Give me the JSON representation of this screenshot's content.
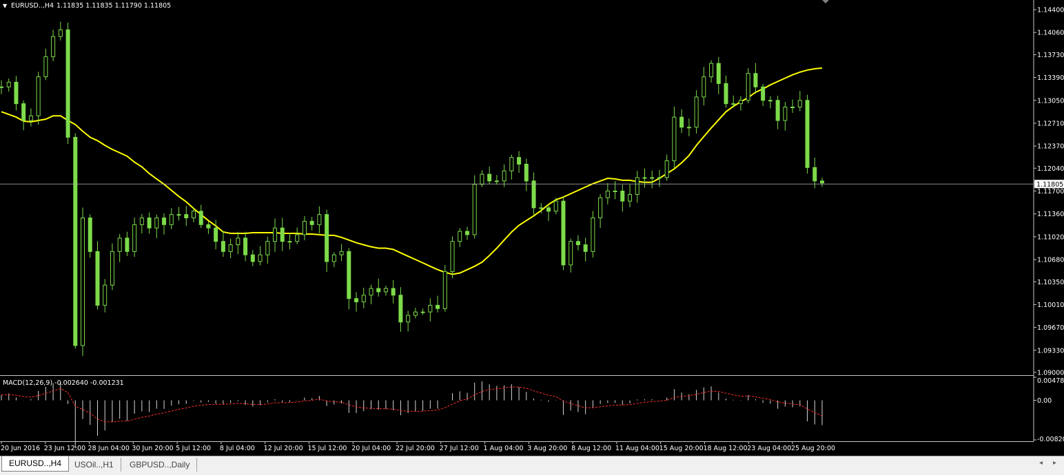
{
  "header": {
    "symbol_label": "EURUSD..,H4",
    "ohlc": "1.11835 1.11835 1.11790 1.11805"
  },
  "macd": {
    "label": "MACD(12,26,9) -0.002640 -0.001231",
    "ticks": [
      "0.004787",
      "0.00",
      "-0.008208"
    ]
  },
  "current_price_label": "1.11805",
  "tabs": [
    {
      "label": "EURUSD..,H4",
      "active": true
    },
    {
      "label": "USOil..,H1",
      "active": false
    },
    {
      "label": "GBPUSD..,Daily",
      "active": false
    }
  ],
  "colors": {
    "background": "#000000",
    "candle": "#7ddb4a",
    "moving_average": "#ffff00",
    "macd_histogram": "#d8d8d8",
    "macd_signal": "#ff3030",
    "axis_text": "#ffffff",
    "price_line": "#b8b8b8"
  },
  "chart_data": {
    "type": "line",
    "ylim": [
      1.09,
      1.144
    ],
    "yticks": [
      "1.14400",
      "1.14060",
      "1.13730",
      "1.13390",
      "1.13050",
      "1.12710",
      "1.12370",
      "1.12040",
      "1.11700",
      "1.11360",
      "1.11020",
      "1.10680",
      "1.10350",
      "1.10010",
      "1.09670",
      "1.09330",
      "1.09000"
    ],
    "xticks": [
      "20 Jun 2016",
      "23 Jun 12:00",
      "28 Jun 04:00",
      "30 Jun 20:00",
      "5 Jul 12:00",
      "8 Jul 04:00",
      "12 Jul 20:00",
      "15 Jul 12:00",
      "20 Jul 04:00",
      "22 Jul 20:00",
      "27 Jul 12:00",
      "1 Aug 04:00",
      "3 Aug 20:00",
      "8 Aug 12:00",
      "11 Aug 04:00",
      "15 Aug 20:00",
      "18 Aug 12:00",
      "23 Aug 04:00",
      "25 Aug 20:00"
    ],
    "current_price": 1.11805,
    "series": [
      {
        "values": [
          1.1325,
          1.1332,
          1.13,
          1.1275,
          1.1282,
          1.134,
          1.137,
          1.14,
          1.141,
          1.125,
          1.094,
          1.113,
          1.108,
          1.1,
          1.103,
          1.108,
          1.11,
          1.108,
          1.112,
          1.113,
          1.1115,
          1.113,
          1.112,
          1.1135,
          1.1135,
          1.113,
          1.114,
          1.112,
          1.1115,
          1.1095,
          1.108,
          1.109,
          1.11,
          1.1075,
          1.1065,
          1.1075,
          1.1095,
          1.1115,
          1.1095,
          1.1095,
          1.1105,
          1.1125,
          1.112,
          1.1135,
          1.1065,
          1.1075,
          1.108,
          1.101,
          1.1005,
          1.1015,
          1.1025,
          1.102,
          1.1025,
          1.1015,
          1.0975,
          1.0985,
          1.099,
          1.099,
          1.1,
          1.0995,
          1.105,
          1.1095,
          1.111,
          1.1105,
          1.118,
          1.1195,
          1.1185,
          1.1185,
          1.12,
          1.122,
          1.121,
          1.1185,
          1.1145,
          1.1145,
          1.114,
          1.1155,
          1.106,
          1.1095,
          1.109,
          1.108,
          1.113,
          1.116,
          1.117,
          1.117,
          1.1155,
          1.1165,
          1.119,
          1.119,
          1.119,
          1.119,
          1.1215,
          1.128,
          1.1265,
          1.1265,
          1.131,
          1.134,
          1.136,
          1.133,
          1.13,
          1.13,
          1.1305,
          1.1345,
          1.1325,
          1.1305,
          1.1305,
          1.1275,
          1.1295,
          1.1295,
          1.1305,
          1.1205,
          1.1185,
          1.1182
        ]
      },
      {
        "values": [
          1.1288,
          1.1284,
          1.128,
          1.1274,
          1.1273,
          1.1275,
          1.1277,
          1.1282,
          1.1282,
          1.1275,
          1.1269,
          1.1259,
          1.125,
          1.1245,
          1.1238,
          1.1232,
          1.1227,
          1.1222,
          1.1213,
          1.1206,
          1.1196,
          1.1188,
          1.118,
          1.1171,
          1.1162,
          1.1154,
          1.1144,
          1.1135,
          1.1126,
          1.1118,
          1.1109,
          1.1107,
          1.1107,
          1.1107,
          1.1108,
          1.1108,
          1.1108,
          1.1108,
          1.1107,
          1.1107,
          1.1107,
          1.1106,
          1.1106,
          1.1105,
          1.1104,
          1.1104,
          1.1101,
          1.1097,
          1.1093,
          1.109,
          1.1087,
          1.1085,
          1.1085,
          1.1083,
          1.1078,
          1.1073,
          1.1068,
          1.1063,
          1.1058,
          1.1053,
          1.1049,
          1.1046,
          1.1048,
          1.1053,
          1.1058,
          1.1064,
          1.1074,
          1.1085,
          1.1097,
          1.1109,
          1.1119,
          1.1126,
          1.1133,
          1.1141,
          1.115,
          1.1157,
          1.1161,
          1.1166,
          1.1171,
          1.1176,
          1.1181,
          1.1185,
          1.1189,
          1.1188,
          1.1186,
          1.1186,
          1.1184,
          1.1183,
          1.1183,
          1.1189,
          1.1196,
          1.1203,
          1.1212,
          1.1223,
          1.1238,
          1.1251,
          1.1264,
          1.1276,
          1.1288,
          1.1296,
          1.1303,
          1.1309,
          1.1317,
          1.1322,
          1.1328,
          1.1333,
          1.1338,
          1.1343,
          1.1347,
          1.135,
          1.1352,
          1.1353
        ]
      }
    ]
  }
}
